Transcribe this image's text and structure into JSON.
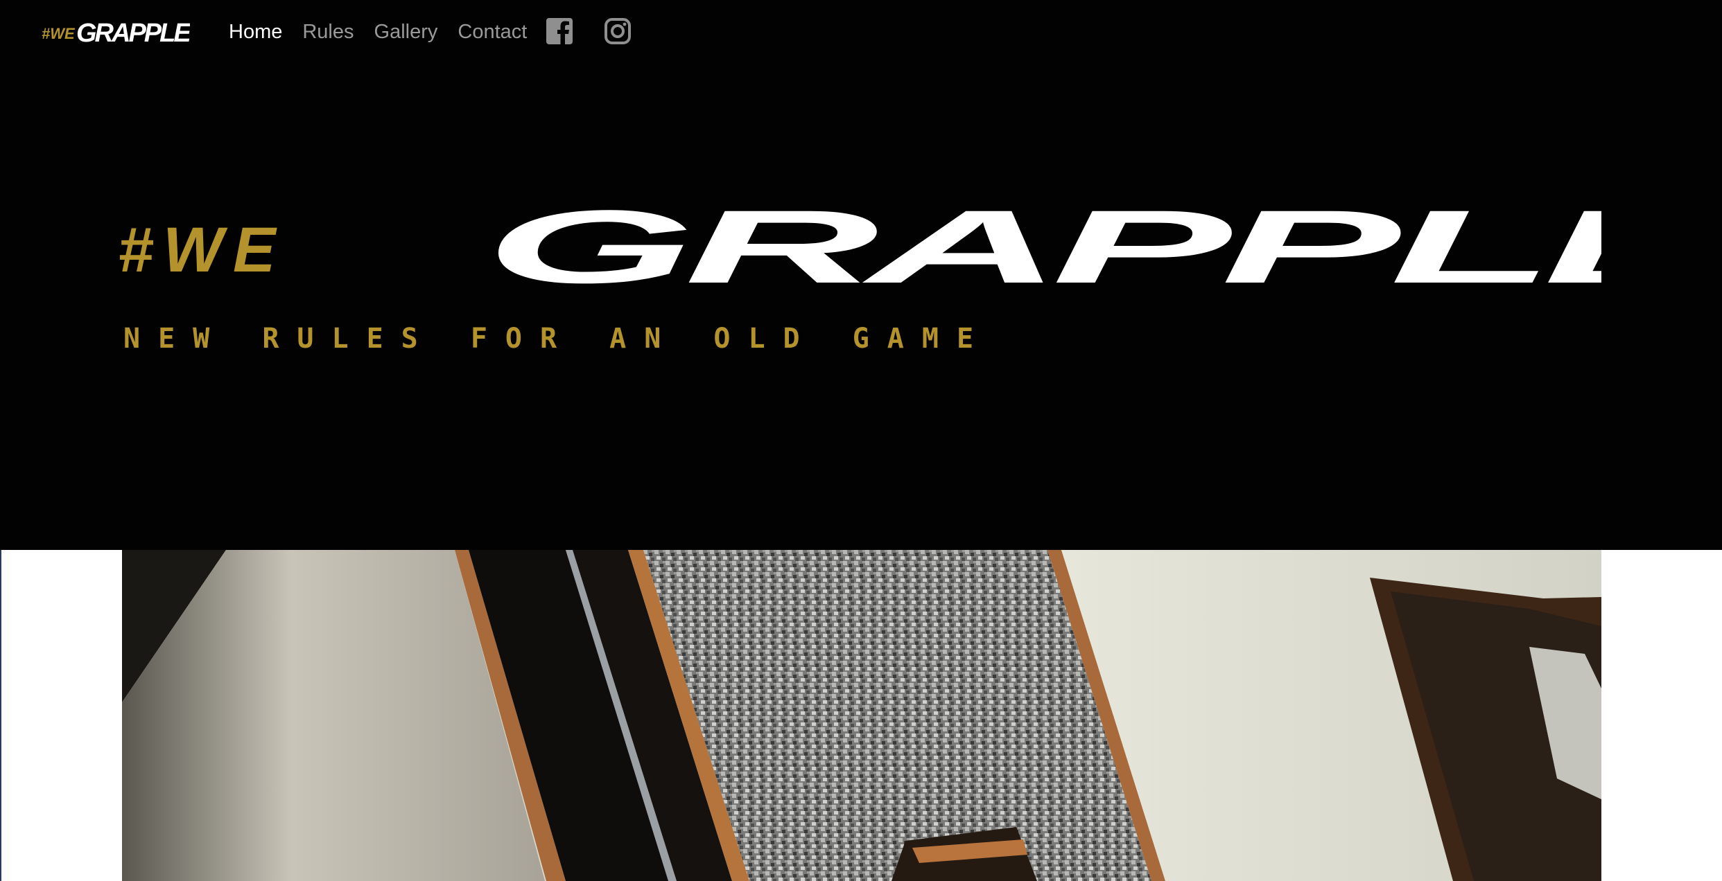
{
  "brand": {
    "hash_we": "#WE",
    "grapple": "GRAPPLE",
    "accent_color": "#b4922c",
    "text_color": "#ffffff"
  },
  "nav": {
    "items": [
      {
        "label": "Home",
        "active": true
      },
      {
        "label": "Rules",
        "active": false
      },
      {
        "label": "Gallery",
        "active": false
      },
      {
        "label": "Contact",
        "active": false
      }
    ],
    "social": [
      {
        "icon": "facebook-icon"
      },
      {
        "icon": "instagram-icon"
      }
    ]
  },
  "hero": {
    "logo_prefix": "#WE",
    "logo_main": "GRAPPLE",
    "tagline": "NEW RULES FOR AN OLD GAME",
    "background_color": "#020202"
  },
  "media": {
    "kind": "video",
    "icon": "video-frame"
  }
}
